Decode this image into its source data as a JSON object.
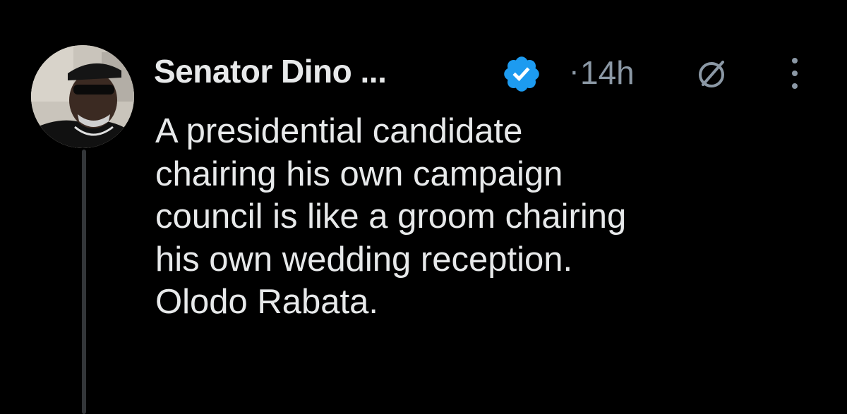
{
  "tweet": {
    "author": {
      "display_name": "Senator Dino ...",
      "verified": true,
      "avatar_icon": "user-avatar"
    },
    "separator": "·",
    "timestamp": "14h",
    "text_lines": [
      "A presidential candidate",
      "chairing his own campaign",
      "council is like a groom chairing",
      "his own wedding reception.",
      "Olodo Rabata."
    ]
  },
  "colors": {
    "background": "#000000",
    "primary_text": "#e7e9ea",
    "secondary_text": "#8b98a5",
    "verified_badge": "#1d9bf0",
    "thread_line": "#333639"
  },
  "icons": {
    "verified": "verified-badge-icon",
    "grok": "grok-icon",
    "more": "more-options-icon"
  }
}
